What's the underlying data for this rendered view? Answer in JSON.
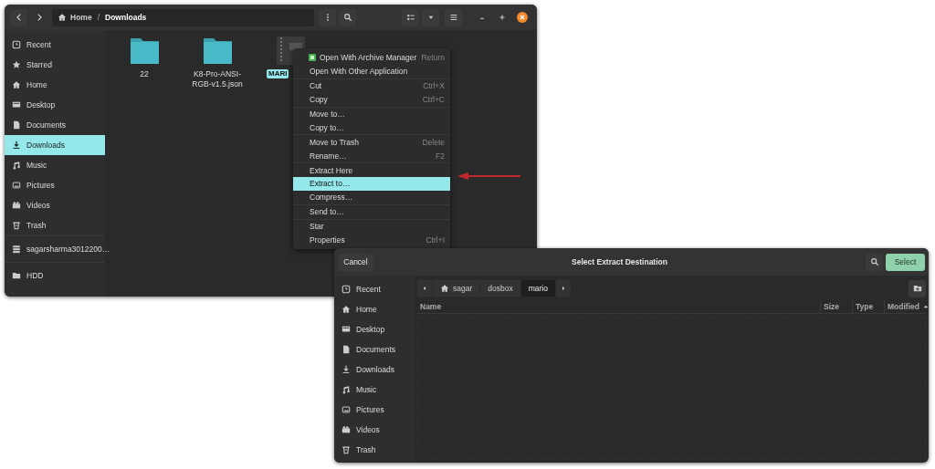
{
  "file_manager": {
    "path": [
      {
        "label": "Home"
      },
      {
        "label": "Downloads"
      }
    ],
    "path_separator": "/",
    "places": [
      {
        "label": "Recent",
        "selected": false
      },
      {
        "label": "Starred",
        "selected": false
      },
      {
        "label": "Home",
        "selected": false
      },
      {
        "label": "Desktop",
        "selected": false
      },
      {
        "label": "Documents",
        "selected": false
      },
      {
        "label": "Downloads",
        "selected": true
      },
      {
        "label": "Music",
        "selected": false
      },
      {
        "label": "Pictures",
        "selected": false
      },
      {
        "label": "Videos",
        "selected": false
      },
      {
        "label": "Trash",
        "selected": false
      }
    ],
    "devices": [
      {
        "label": "sagarsharma3012200…",
        "kind": "disk",
        "selected": false
      },
      {
        "label": "HDD",
        "kind": "folder",
        "selected": false
      }
    ],
    "files": [
      {
        "name": "22",
        "kind": "folder",
        "selected": false
      },
      {
        "name": "K8-Pro-ANSI-RGB-v1.5.json",
        "kind": "folder",
        "selected": false
      },
      {
        "name": "MARI",
        "kind": "zip",
        "selected": true
      }
    ],
    "context_menu": [
      [
        {
          "label": "Open With Archive Manager",
          "shortcut": "Return",
          "selected": false
        },
        {
          "label": "Open With Other Application",
          "selected": false
        }
      ],
      [
        {
          "label": "Cut",
          "shortcut": "Ctrl+X",
          "selected": false
        },
        {
          "label": "Copy",
          "shortcut": "Ctrl+C",
          "selected": false
        }
      ],
      [
        {
          "label": "Move to…",
          "selected": false
        },
        {
          "label": "Copy to…",
          "selected": false
        }
      ],
      [
        {
          "label": "Move to Trash",
          "shortcut": "Delete",
          "selected": false
        },
        {
          "label": "Rename…",
          "shortcut": "F2",
          "selected": false
        }
      ],
      [
        {
          "label": "Extract Here",
          "selected": false
        },
        {
          "label": "Extract to…",
          "selected": true
        },
        {
          "label": "Compress…",
          "selected": false
        }
      ],
      [
        {
          "label": "Send to…",
          "selected": false
        }
      ],
      [
        {
          "label": "Star",
          "selected": false
        },
        {
          "label": "Properties",
          "shortcut": "Ctrl+I",
          "selected": false
        }
      ]
    ]
  },
  "dialog": {
    "cancel": "Cancel",
    "title": "Select Extract Destination",
    "select": "Select",
    "places": [
      {
        "label": "Recent",
        "selected": false
      },
      {
        "label": "Home",
        "selected": false
      },
      {
        "label": "Desktop",
        "selected": false
      },
      {
        "label": "Documents",
        "selected": false
      },
      {
        "label": "Downloads",
        "selected": false
      },
      {
        "label": "Music",
        "selected": false
      },
      {
        "label": "Pictures",
        "selected": false
      },
      {
        "label": "Videos",
        "selected": false
      },
      {
        "label": "Trash",
        "selected": false
      }
    ],
    "path": [
      {
        "label": "sagar",
        "kind": "home",
        "selected": false
      },
      {
        "label": "dosbox",
        "kind": "folder",
        "selected": false
      },
      {
        "label": "mario",
        "kind": "folder",
        "selected": true
      }
    ],
    "columns": [
      "Name",
      "Size",
      "Type",
      "Modified"
    ]
  }
}
